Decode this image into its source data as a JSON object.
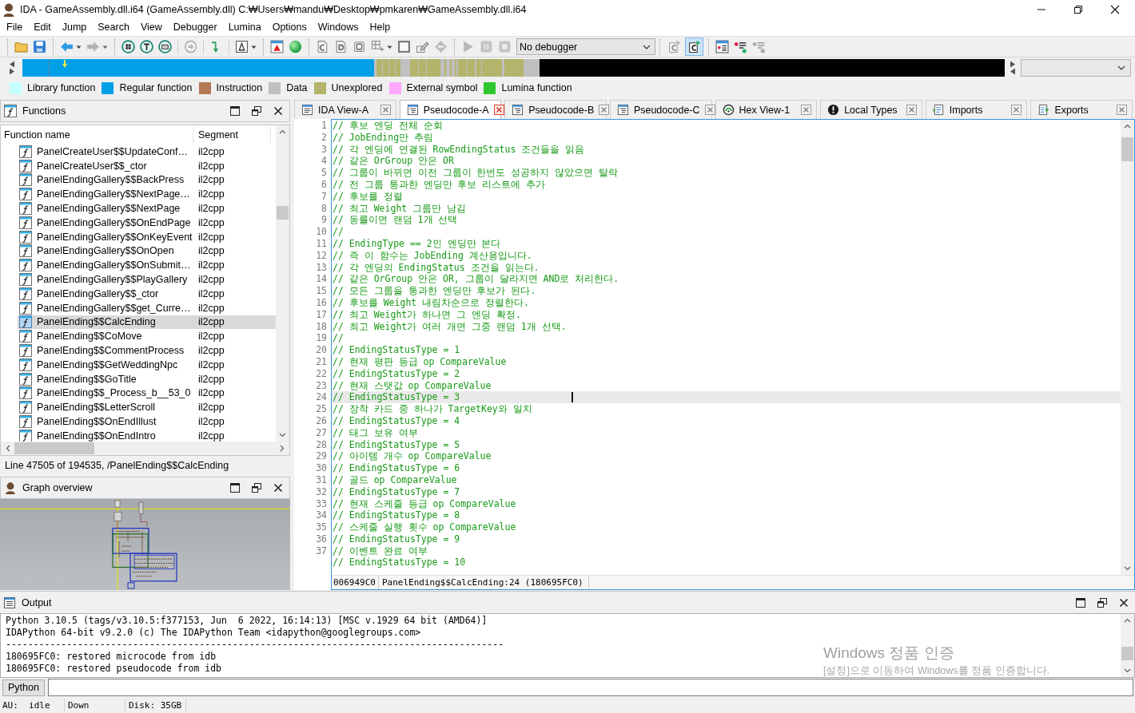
{
  "window": {
    "title": "IDA - GameAssembly.dll.i64 (GameAssembly.dll) C:₩Users₩mandu₩Desktop₩pmkaren₩GameAssembly.dll.i64"
  },
  "menu": [
    "File",
    "Edit",
    "Jump",
    "Search",
    "View",
    "Debugger",
    "Lumina",
    "Options",
    "Windows",
    "Help"
  ],
  "toolbar": {
    "debugger": "No debugger",
    "decompiler_toggles": [
      {
        "pressed": false
      },
      {
        "pressed": true
      }
    ]
  },
  "legend": [
    {
      "label": "Library function",
      "color": "#c4ffff"
    },
    {
      "label": "Regular function",
      "color": "#00a0e8"
    },
    {
      "label": "Instruction",
      "color": "#b47a56"
    },
    {
      "label": "Data",
      "color": "#c0c0c0"
    },
    {
      "label": "Unexplored",
      "color": "#b4b46c"
    },
    {
      "label": "External symbol",
      "color": "#ffa8ff"
    },
    {
      "label": "Lumina function",
      "color": "#2ec82e"
    }
  ],
  "functions_panel": {
    "title": "Functions",
    "columns": [
      "Function name",
      "Segment"
    ],
    "rows": [
      {
        "name": "PanelCreateUser$$UpdateConf…",
        "segment": "il2cpp",
        "selected": false
      },
      {
        "name": "PanelCreateUser$$_ctor",
        "segment": "il2cpp",
        "selected": false
      },
      {
        "name": "PanelEndingGallery$$BackPress",
        "segment": "il2cpp",
        "selected": false
      },
      {
        "name": "PanelEndingGallery$$NextPage…",
        "segment": "il2cpp",
        "selected": false
      },
      {
        "name": "PanelEndingGallery$$NextPage",
        "segment": "il2cpp",
        "selected": false
      },
      {
        "name": "PanelEndingGallery$$OnEndPage",
        "segment": "il2cpp",
        "selected": false
      },
      {
        "name": "PanelEndingGallery$$OnKeyEvent",
        "segment": "il2cpp",
        "selected": false
      },
      {
        "name": "PanelEndingGallery$$OnOpen",
        "segment": "il2cpp",
        "selected": false
      },
      {
        "name": "PanelEndingGallery$$OnSubmit…",
        "segment": "il2cpp",
        "selected": false
      },
      {
        "name": "PanelEndingGallery$$PlayGallery",
        "segment": "il2cpp",
        "selected": false
      },
      {
        "name": "PanelEndingGallery$$_ctor",
        "segment": "il2cpp",
        "selected": false
      },
      {
        "name": "PanelEndingGallery$$get_Curre…",
        "segment": "il2cpp",
        "selected": false
      },
      {
        "name": "PanelEnding$$CalcEnding",
        "segment": "il2cpp",
        "selected": true
      },
      {
        "name": "PanelEnding$$CoMove",
        "segment": "il2cpp",
        "selected": false
      },
      {
        "name": "PanelEnding$$CommentProcess",
        "segment": "il2cpp",
        "selected": false
      },
      {
        "name": "PanelEnding$$GetWeddingNpc",
        "segment": "il2cpp",
        "selected": false
      },
      {
        "name": "PanelEnding$$GoTitle",
        "segment": "il2cpp",
        "selected": false
      },
      {
        "name": "PanelEnding$$_Process_b__53_0",
        "segment": "il2cpp",
        "selected": false
      },
      {
        "name": "PanelEnding$$LetterScroll",
        "segment": "il2cpp",
        "selected": false
      },
      {
        "name": "PanelEnding$$OnEndIllust",
        "segment": "il2cpp",
        "selected": false
      },
      {
        "name": "PanelEnding$$OnEndIntro",
        "segment": "il2cpp",
        "selected": false
      }
    ],
    "status": "Line 47505 of 194535, /PanelEnding$$CalcEnding"
  },
  "graph_overview": {
    "title": "Graph overview"
  },
  "tabs": [
    {
      "label": "IDA View-A",
      "kind": "disassembly",
      "selected": false
    },
    {
      "label": "Pseudocode-A",
      "kind": "pseudocode",
      "selected": true
    },
    {
      "label": "Pseudocode-B",
      "kind": "pseudocode",
      "selected": false
    },
    {
      "label": "Pseudocode-C",
      "kind": "pseudocode",
      "selected": false
    },
    {
      "label": "Hex View-1",
      "kind": "hex",
      "selected": false
    },
    {
      "label": "Local Types",
      "kind": "types",
      "selected": false
    },
    {
      "label": "Imports",
      "kind": "imports",
      "selected": false
    },
    {
      "label": "Exports",
      "kind": "exports",
      "selected": false
    }
  ],
  "editor": {
    "lines": [
      {
        "number": "1",
        "text": "// 후보 엔딩 전체 순회",
        "current": false
      },
      {
        "number": "2",
        "text": "// JobEnding만 추림",
        "current": false
      },
      {
        "number": "3",
        "text": "// 각 엔딩에 연결된 RowEndingStatus 조건들을 읽음",
        "current": false
      },
      {
        "number": "4",
        "text": "// 같은 OrGroup 안은 OR",
        "current": false
      },
      {
        "number": "5",
        "text": "// 그룹이 바뀌면 이전 그룹이 한번도 성공하지 않았으면 탈락",
        "current": false
      },
      {
        "number": "6",
        "text": "// 전 그룹 통과한 엔딩만 후보 리스트에 추가",
        "current": false
      },
      {
        "number": "7",
        "text": "// 후보를 정렬",
        "current": false
      },
      {
        "number": "8",
        "text": "// 최고 Weight 그룹만 남김",
        "current": false
      },
      {
        "number": "9",
        "text": "// 동률이면 랜덤 1개 선택",
        "current": false
      },
      {
        "number": "10",
        "text": "//",
        "current": false
      },
      {
        "number": "11",
        "text": "// EndingType == 2인 엔딩만 본다",
        "current": false
      },
      {
        "number": "12",
        "text": "// 즉 이 함수는 JobEnding 계산용입니다.",
        "current": false
      },
      {
        "number": "13",
        "text": "// 각 엔딩의 EndingStatus 조건을 읽는다.",
        "current": false
      },
      {
        "number": "14",
        "text": "// 같은 OrGroup 안은 OR, 그룹이 달라지면 AND로 처리한다.",
        "current": false
      },
      {
        "number": "15",
        "text": "// 모든 그룹을 통과한 엔딩만 후보가 된다.",
        "current": false
      },
      {
        "number": "16",
        "text": "// 후보를 Weight 내림차순으로 정렬한다.",
        "current": false
      },
      {
        "number": "17",
        "text": "// 최고 Weight가 하나면 그 엔딩 확정.",
        "current": false
      },
      {
        "number": "18",
        "text": "// 최고 Weight가 여러 개면 그중 랜덤 1개 선택.",
        "current": false
      },
      {
        "number": "19",
        "text": "//",
        "current": false
      },
      {
        "number": "20",
        "text": "// EndingStatusType = 1",
        "current": false
      },
      {
        "number": "21",
        "text": "// 현재 평판 등급 op CompareValue",
        "current": false
      },
      {
        "number": "22",
        "text": "// EndingStatusType = 2",
        "current": false
      },
      {
        "number": "23",
        "text": "// 현재 스탯값 op CompareValue",
        "current": false
      },
      {
        "number": "24",
        "text": "// EndingStatusType = 3",
        "current": true
      },
      {
        "number": "25",
        "text": "// 장착 카드 중 하나가 TargetKey와 일치",
        "current": false
      },
      {
        "number": "26",
        "text": "// EndingStatusType = 4",
        "current": false
      },
      {
        "number": "27",
        "text": "// 태그 보유 여부",
        "current": false
      },
      {
        "number": "28",
        "text": "// EndingStatusType = 5",
        "current": false
      },
      {
        "number": "29",
        "text": "// 아이템 개수 op CompareValue",
        "current": false
      },
      {
        "number": "30",
        "text": "// EndingStatusType = 6",
        "current": false
      },
      {
        "number": "31",
        "text": "// 골드 op CompareValue",
        "current": false
      },
      {
        "number": "32",
        "text": "// EndingStatusType = 7",
        "current": false
      },
      {
        "number": "33",
        "text": "// 현재 스케줄 등급 op CompareValue",
        "current": false
      },
      {
        "number": "34",
        "text": "// EndingStatusType = 8",
        "current": false
      },
      {
        "number": "35",
        "text": "// 스케줄 실행 횟수 op CompareValue",
        "current": false
      },
      {
        "number": "36",
        "text": "// EndingStatusType = 9",
        "current": false
      },
      {
        "number": "37",
        "text": "// 이벤트 완료 여부",
        "current": false
      },
      {
        "text": "// EndingStatusType = 10",
        "current": false
      }
    ],
    "status": {
      "address": "006949C0",
      "location": "PanelEnding$$CalcEnding:24 (180695FC0)"
    }
  },
  "output": {
    "title": "Output",
    "lines": [
      "Python 3.10.5 (tags/v3.10.5:f377153, Jun  6 2022, 16:14:13) [MSC v.1929 64 bit (AMD64)]",
      "IDAPython 64-bit v9.2.0 (c) The IDAPython Team <idapython@googlegroups.com>",
      "------------------------------------------------------------------------------------------",
      "180695FC0: restored microcode from idb",
      "180695FC0: restored pseudocode from idb"
    ]
  },
  "python_console": {
    "button": "Python"
  },
  "status_bar": [
    "AU:  idle",
    "Down",
    "Disk: 35GB"
  ],
  "activation_notice": {
    "title": "Windows 정품 인증",
    "text": "[설정]으로 이동하여 Windows를 정품 인증합니다."
  }
}
